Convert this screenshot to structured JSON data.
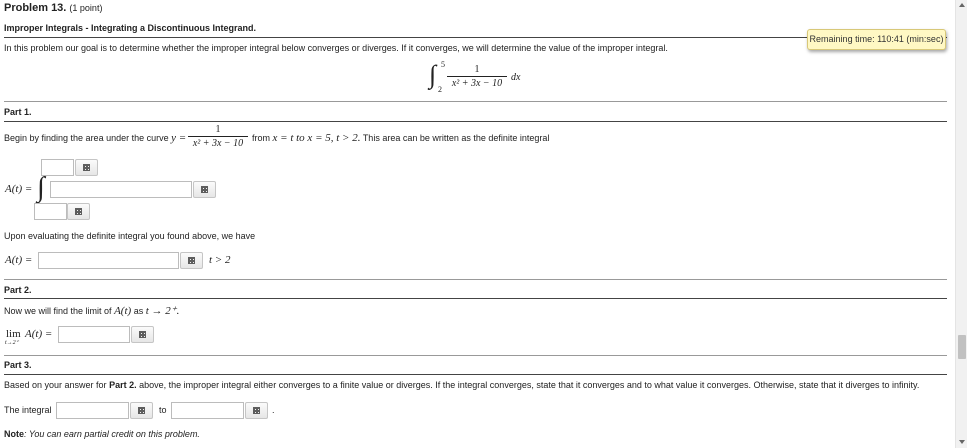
{
  "problem": {
    "title": "Problem 13.",
    "points": "(1 point)",
    "heading": "Improper Integrals - Integrating a Discontinuous Integrand.",
    "intro": "In this problem our goal is to determine whether the improper integral below converges or diverges. If it converges, we will determine the value of the improper integral."
  },
  "timer": {
    "text": "Remaining time: 110:41 (min:sec)"
  },
  "main_integral": {
    "upper": "5",
    "lower": "2",
    "numerator": "1",
    "denominator": "x² + 3x − 10",
    "dx": "dx"
  },
  "part1": {
    "title": "Part 1.",
    "text_a": "Begin by finding the area under the curve",
    "y_eq": "y =",
    "numerator": "1",
    "denominator": "x² + 3x − 10",
    "text_b": "from",
    "range": "x = t to x = 5, t > 2.",
    "text_c": "This area can be written as the definite integral",
    "lhs": "A(t) =",
    "eval_text": "Upon evaluating the definite integral you found above, we have",
    "lhs2": "A(t) =",
    "condition": "t > 2"
  },
  "part2": {
    "title": "Part 2.",
    "text": "Now we will find the limit of",
    "expr": "A(t)",
    "as": "as",
    "limit": "t → 2⁺.",
    "lim": "lim",
    "lim_sub": "t→2⁺",
    "lim_expr": "A(t) ="
  },
  "part3": {
    "title": "Part 3.",
    "text_a": "Based on your answer for",
    "bold_ref": "Part 2.",
    "text_b": "above, the improper integral either converges to a finite value or diverges. If the integral converges, state that it converges and to what value it converges. Otherwise, state that it diverges to infinity.",
    "label": "The integral",
    "to": "to",
    "period": "."
  },
  "note": {
    "label": "Note",
    "text": ": You can earn partial credit on this problem."
  }
}
